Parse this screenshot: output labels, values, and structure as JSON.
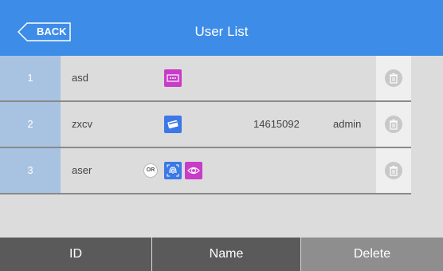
{
  "header": {
    "back_label": "BACK",
    "title": "User List"
  },
  "rows": [
    {
      "id": "1",
      "name": "asd",
      "card": "",
      "privilege": "",
      "icons": [
        "password-icon"
      ]
    },
    {
      "id": "2",
      "name": "zxcv",
      "card": "14615092",
      "privilege": "admin",
      "icons": [
        "card-icon"
      ]
    },
    {
      "id": "3",
      "name": "aser",
      "card": "",
      "privilege": "",
      "or_label": "OR",
      "icons": [
        "fingerprint-icon",
        "iris-icon"
      ]
    }
  ],
  "footer": {
    "id_label": "ID",
    "name_label": "Name",
    "delete_label": "Delete"
  },
  "colors": {
    "header": "#3d8ce8",
    "id_cell": "#a8c2e2",
    "magenta_icon": "#c83cc8",
    "blue_icon": "#3c78e6",
    "footer_dark": "#5a5a5a",
    "footer_light": "#8e8e8e"
  }
}
